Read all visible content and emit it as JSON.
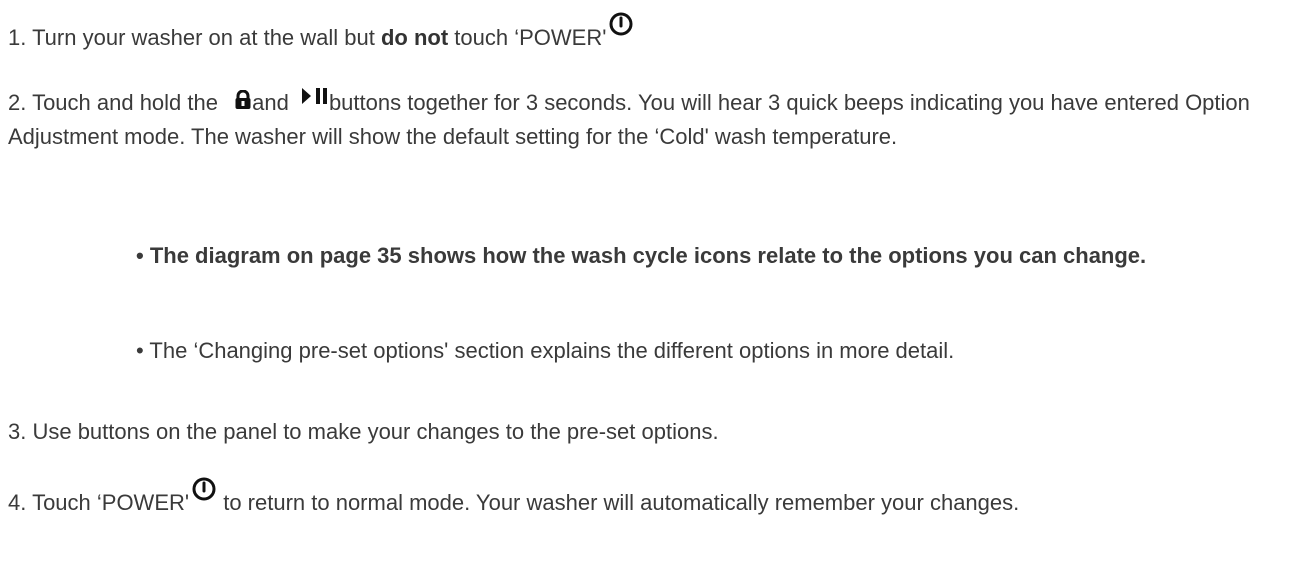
{
  "steps": {
    "step1": {
      "text_a": "1. Turn your washer on at the wall but ",
      "bold": "do not",
      "text_b": " touch ‘POWER'",
      "icon": "power-icon"
    },
    "step2": {
      "text_a": "2. Touch and hold the ",
      "icon1": "lock-icon",
      "text_b": "and ",
      "icon2": "play-pause-icon",
      "text_c": "buttons together for 3 seconds. You will hear 3 quick beeps indicating you have entered Option Adjustment mode. The washer will show the default setting for the ‘Cold' wash temperature."
    },
    "bullets": [
      "• The diagram on page 35 shows how the wash cycle icons relate to the options you can change.",
      "• The ‘Changing pre-set options' section explains the different options in more detail."
    ],
    "step3": {
      "text": "3. Use buttons on the panel to make your changes to the pre-set options."
    },
    "step4": {
      "text_a": "4. Touch ‘POWER'",
      "icon": "power-icon",
      "text_b": " to return to normal mode. Your washer will automatically remember your changes."
    }
  },
  "colors": {
    "text": "#3a3a3a",
    "icon": "#111111",
    "background": "#ffffff"
  }
}
